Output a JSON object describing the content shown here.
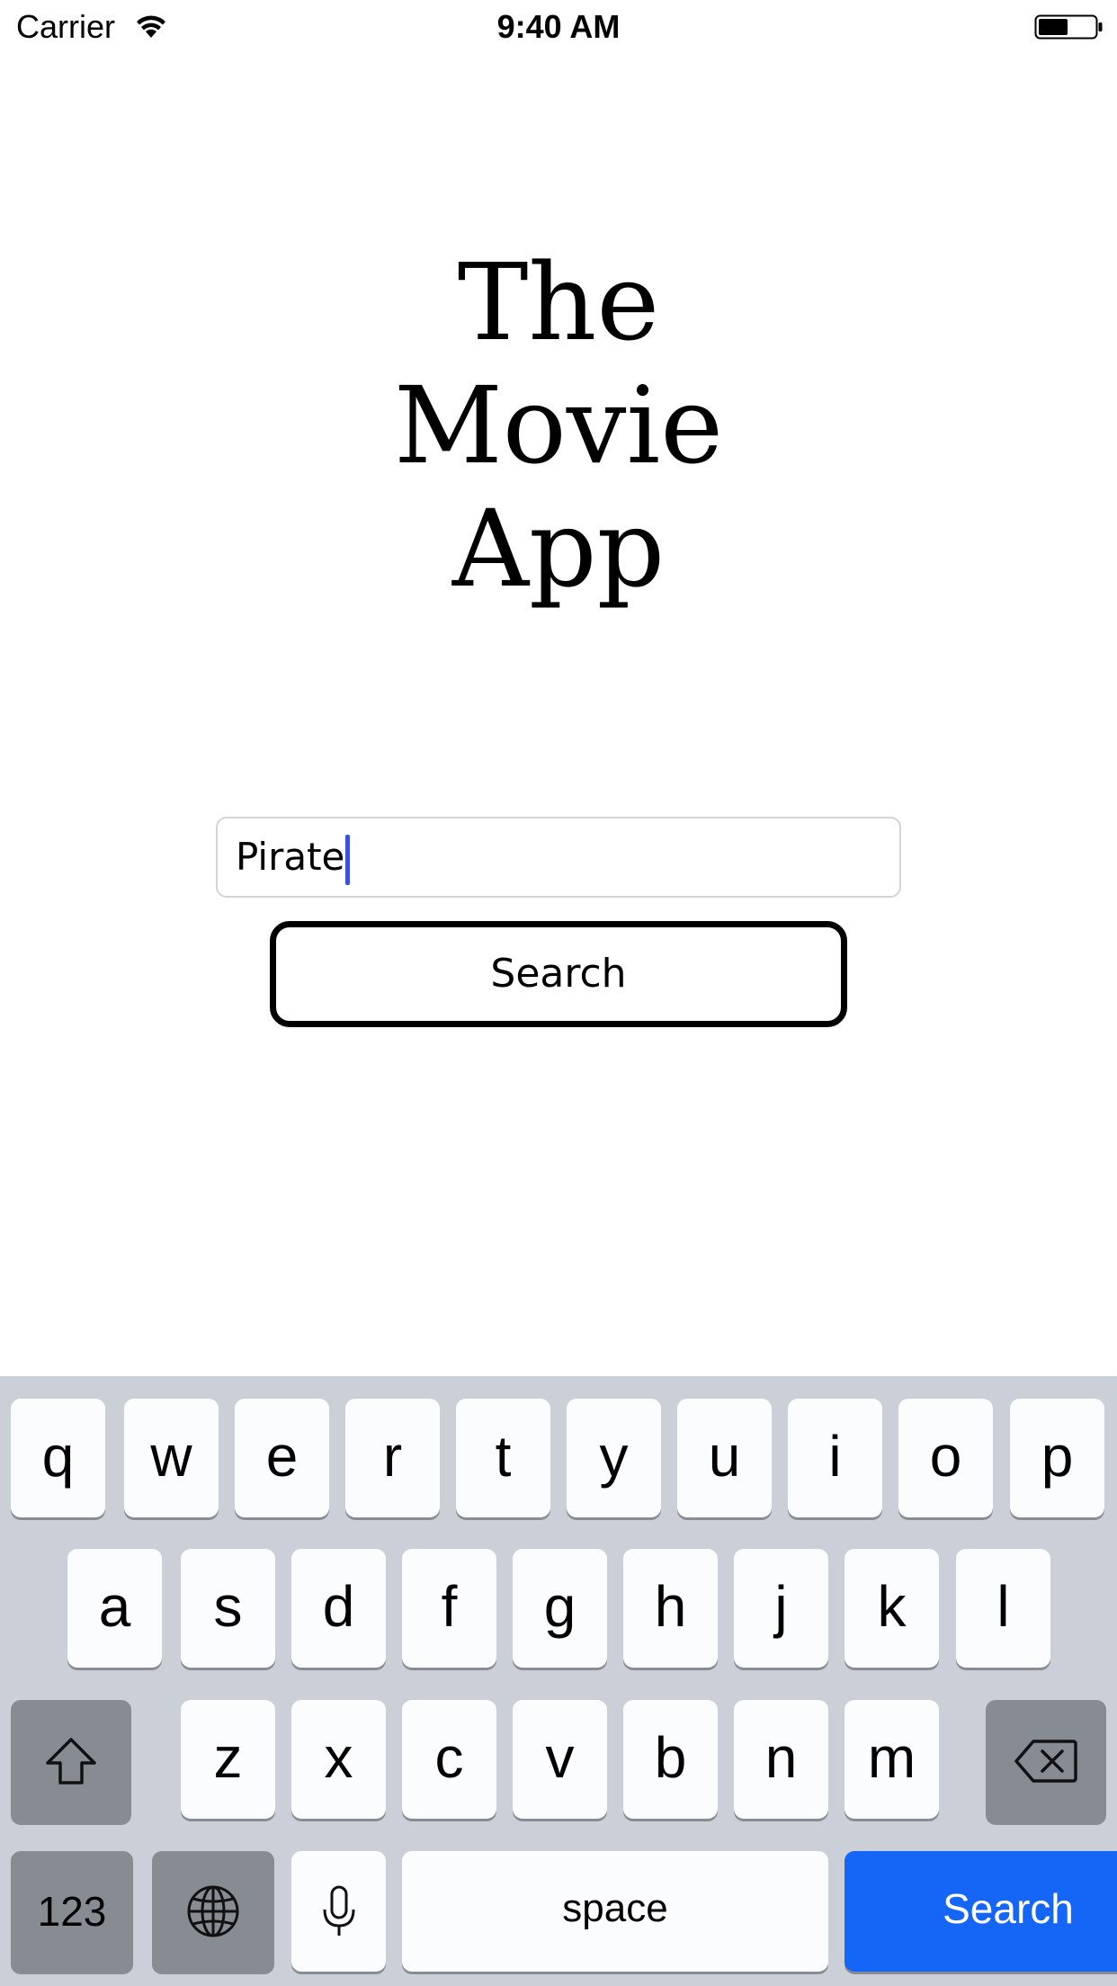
{
  "status_bar": {
    "carrier": "Carrier",
    "time": "9:40 AM",
    "wifi_icon": "wifi-icon",
    "battery_icon": "battery-icon"
  },
  "title": {
    "line1": "The",
    "line2": "Movie",
    "line3": "App"
  },
  "search": {
    "input_value": "Pirate",
    "button_label": "Search"
  },
  "keyboard": {
    "row1": [
      "q",
      "w",
      "e",
      "r",
      "t",
      "y",
      "u",
      "i",
      "o",
      "p"
    ],
    "row2": [
      "a",
      "s",
      "d",
      "f",
      "g",
      "h",
      "j",
      "k",
      "l"
    ],
    "row3": [
      "z",
      "x",
      "c",
      "v",
      "b",
      "n",
      "m"
    ],
    "shift_icon": "shift-icon",
    "backspace_icon": "backspace-icon",
    "numbers_label": "123",
    "globe_icon": "globe-icon",
    "mic_icon": "microphone-icon",
    "space_label": "space",
    "return_label": "Search",
    "colors": {
      "background": "#cbd0d8",
      "key": "#fbfcfd",
      "dark_key": "#878c93",
      "return_key": "#1565f7"
    }
  }
}
